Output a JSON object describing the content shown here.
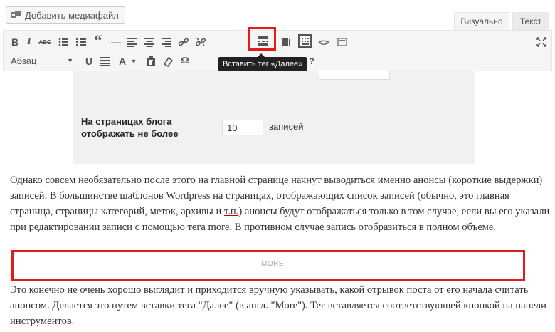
{
  "media_button": {
    "label": "Добавить медиафайл"
  },
  "tabs": {
    "visual": "Визуально",
    "text": "Текст"
  },
  "toolbar": {
    "row1": [
      {
        "name": "bold",
        "glyph": "B"
      },
      {
        "name": "italic",
        "glyph": "I"
      },
      {
        "name": "strikethrough",
        "glyph": "ABC"
      },
      {
        "name": "bullet-list"
      },
      {
        "name": "numbered-list"
      },
      {
        "name": "blockquote",
        "glyph": "“"
      },
      {
        "name": "horizontal-line",
        "glyph": "—"
      },
      {
        "name": "align-left"
      },
      {
        "name": "align-center"
      },
      {
        "name": "align-right"
      },
      {
        "name": "insert-link"
      },
      {
        "name": "remove-link"
      },
      {
        "name": "insert-more"
      },
      {
        "name": "distraction-free"
      },
      {
        "name": "toolbar-toggle"
      },
      {
        "name": "code"
      },
      {
        "name": "page-break"
      },
      {
        "name": "fullscreen"
      }
    ],
    "format_select": "Абзац",
    "row2": [
      {
        "name": "underline",
        "glyph": "U"
      },
      {
        "name": "justify"
      },
      {
        "name": "text-color",
        "glyph": "A"
      },
      {
        "name": "paste-as-text"
      },
      {
        "name": "clear-formatting"
      },
      {
        "name": "special-character",
        "glyph": "Ω"
      },
      {
        "name": "help",
        "glyph": "?"
      }
    ]
  },
  "tooltip": "Вставить тег «Далее»",
  "embedded_screenshot": {
    "label": "На страницах блога отображать не более",
    "value": "10",
    "unit": "записей"
  },
  "content": {
    "paragraph1_a": "Однако совсем необязательно после этого на главной странице начнут выводиться именно анонсы (короткие выдержки) записей. В большинстве шаблонов Wordpress на страницах, отображающих список записей (обычно, это главная страница, страницы категорий, меток, архивы и ",
    "paragraph1_underlined": "т.п.",
    "paragraph1_b": ") анонсы будут отображаться только в том случае, если вы его указали при редактировании записи с помощью тега more. В противном случае запись отобразиться в полном объеме.",
    "more_label": "MORE",
    "paragraph2": "Это конечно не очень хорошо выглядит и приходится вручную указывать, какой отрывок поста от его начала считать анонсом. Делается это путем вставки тега \"Далее\" (в англ. \"More\"). Тег вставляется соответствующей кнопкой на панели инструментов."
  },
  "colors": {
    "highlight": "#e21b1b",
    "toolbar_bg": "#f5f5f5",
    "tooltip_bg": "#222222"
  }
}
